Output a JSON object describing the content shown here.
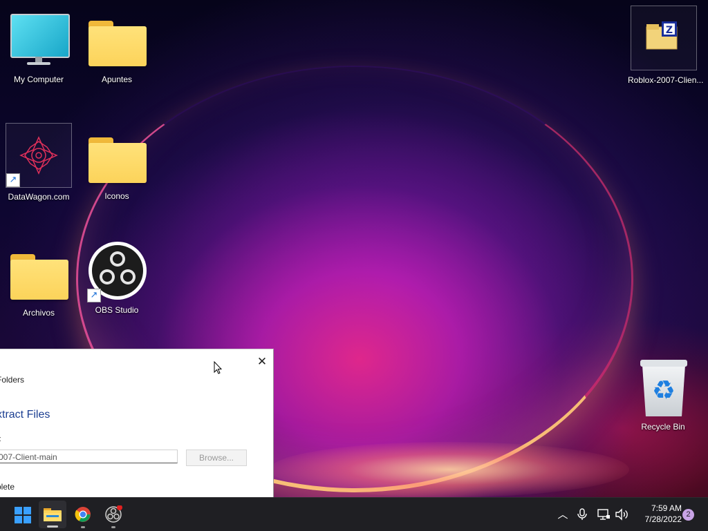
{
  "desktop": {
    "icons": [
      {
        "label": "My Computer"
      },
      {
        "label": "Apuntes"
      },
      {
        "label": "DataWagon.com"
      },
      {
        "label": "Iconos"
      },
      {
        "label": "Archivos"
      },
      {
        "label": "OBS Studio"
      },
      {
        "label": "Roblox-2007-Clien..."
      },
      {
        "label": "Recycle Bin"
      }
    ]
  },
  "dialog": {
    "subtitle": "Folders",
    "title": "xtract Files",
    "field_label": "r:",
    "path_value": "007-Client-main",
    "browse_label": "Browse...",
    "status": "plete",
    "close_glyph": "✕"
  },
  "taskbar": {
    "apps": [
      {
        "name": "Start",
        "icon": "windows-logo"
      },
      {
        "name": "File Explorer",
        "icon": "folder-icon"
      },
      {
        "name": "Google Chrome",
        "icon": "chrome-icon"
      },
      {
        "name": "OBS Studio",
        "icon": "obs-icon"
      }
    ],
    "tray": {
      "time": "7:59 AM",
      "date": "7/28/2022",
      "notification_count": "2"
    }
  },
  "colors": {
    "taskbar_bg": "#1f1f23",
    "folder_yellow": "#fcd35a",
    "accent_blue": "#3aa0ff",
    "dialog_title": "#1b3e91"
  }
}
